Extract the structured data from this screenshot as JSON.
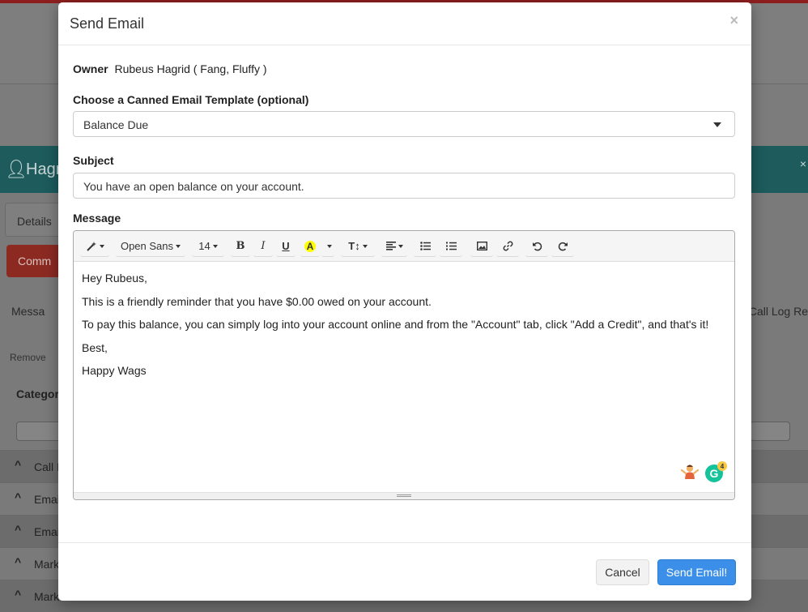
{
  "background": {
    "client_name": "Hagri",
    "tab_details": "Details",
    "tab_comm": "Comm",
    "tab_messages": "Messa",
    "tab_call_log": "Call Log Re",
    "remove_label": "Remove",
    "category_label": "Categor",
    "rows": [
      "Call I",
      "Emai",
      "Emai",
      "Mark",
      "Mark"
    ]
  },
  "modal": {
    "title": "Send Email",
    "close_symbol": "×",
    "owner_label": "Owner",
    "owner_value": "Rubeus Hagrid ( Fang, Fluffy )",
    "template_label": "Choose a Canned Email Template (optional)",
    "template_selected": "Balance Due",
    "subject_label": "Subject",
    "subject_value": "You have an open balance on your account.",
    "message_label": "Message",
    "toolbar": {
      "font_name": "Open Sans",
      "font_size": "14"
    },
    "message_lines": [
      "Hey Rubeus,",
      "This is a friendly reminder that you have $0.00 owed on your account.",
      "To pay this balance, you can simply log into your account online and from the \"Account\" tab, click \"Add a Credit\",  and that's it!",
      "Best,",
      "Happy Wags"
    ],
    "grammarly_count": "4",
    "cancel_label": "Cancel",
    "send_label": "Send Email!"
  },
  "colors": {
    "primary": "#3b8fe8",
    "teal_banner": "#1d5b5d",
    "danger": "#8c2a22",
    "grammarly": "#15c39a"
  }
}
